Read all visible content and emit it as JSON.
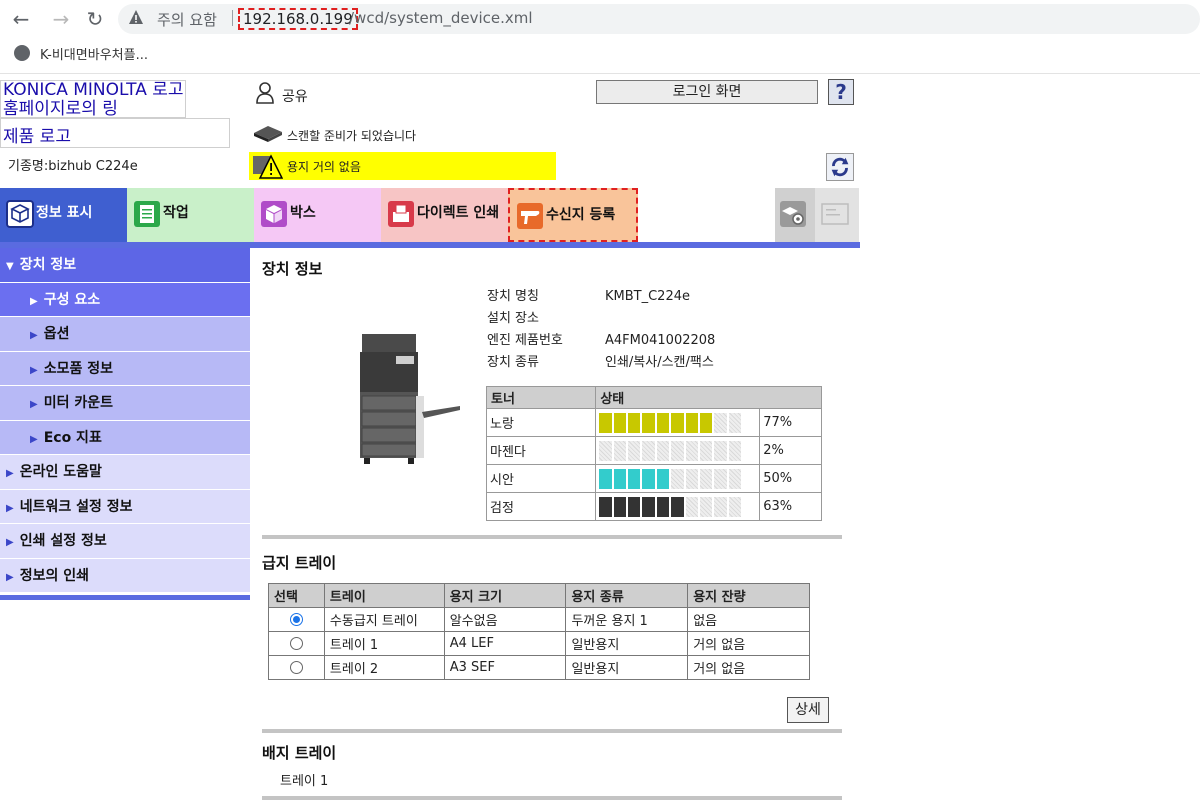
{
  "browser": {
    "security_label": "주의 요함",
    "url_host": "192.168.0.199",
    "url_path": "/wcd/system_device.xml",
    "bookmark": "K-비대면바우처플..."
  },
  "header": {
    "logo_alt": "KONICA MINOLTA 로고 홈페이지로의 링",
    "product_alt": "제품 로고",
    "model": "기종명:bizhub C224e",
    "user": "공유",
    "login_button": "로그인 화면",
    "help": "?",
    "scan_status": "스캔할 준비가 되었습니다",
    "paper_warning": "용지 거의 없음"
  },
  "tabs": [
    {
      "label": "정보 표시"
    },
    {
      "label": "작업"
    },
    {
      "label": "박스"
    },
    {
      "label": "다이렉트 인쇄"
    },
    {
      "label": "수신지 등록"
    }
  ],
  "sidebar": {
    "head": "장치 정보",
    "subs": [
      "구성 요소",
      "옵션",
      "소모품 정보",
      "미터 카운트",
      "Eco 지표"
    ],
    "tops": [
      "온라인 도움말",
      "네트워크 설정 정보",
      "인쇄 설정 정보",
      "정보의 인쇄"
    ]
  },
  "device": {
    "title": "장치 정보",
    "rows": [
      {
        "k": "장치 명칭",
        "v": "KMBT_C224e"
      },
      {
        "k": "설치 장소",
        "v": ""
      },
      {
        "k": "엔진 제품번호",
        "v": "A4FM041002208"
      },
      {
        "k": "장치 종류",
        "v": "인쇄/복사/스캔/팩스"
      }
    ]
  },
  "toner": {
    "headers": [
      "토너",
      "상태"
    ],
    "rows": [
      {
        "name": "노랑",
        "pct": "77%",
        "level": 77,
        "color": "#c8c800"
      },
      {
        "name": "마젠다",
        "pct": "2%",
        "level": 2,
        "color": "#ff00ff"
      },
      {
        "name": "시안",
        "pct": "50%",
        "level": 50,
        "color": "#33cccc"
      },
      {
        "name": "검정",
        "pct": "63%",
        "level": 63,
        "color": "#333333"
      }
    ]
  },
  "tray": {
    "title": "급지 트레이",
    "headers": [
      "선택",
      "트레이",
      "용지 크기",
      "용지 종류",
      "용지 잔량"
    ],
    "rows": [
      {
        "selected": true,
        "tray": "수동급지 트레이",
        "size": "알수없음",
        "type": "두꺼운 용지 1",
        "remain": "없음"
      },
      {
        "selected": false,
        "tray": "트레이 1",
        "size": "A4 LEF",
        "type": "일반용지",
        "remain": "거의 없음"
      },
      {
        "selected": false,
        "tray": "트레이 2",
        "size": "A3 SEF",
        "type": "일반용지",
        "remain": "거의 없음"
      }
    ],
    "detail_button": "상세"
  },
  "exit_tray": {
    "title": "배지 트레이",
    "item": "트레이 1"
  }
}
